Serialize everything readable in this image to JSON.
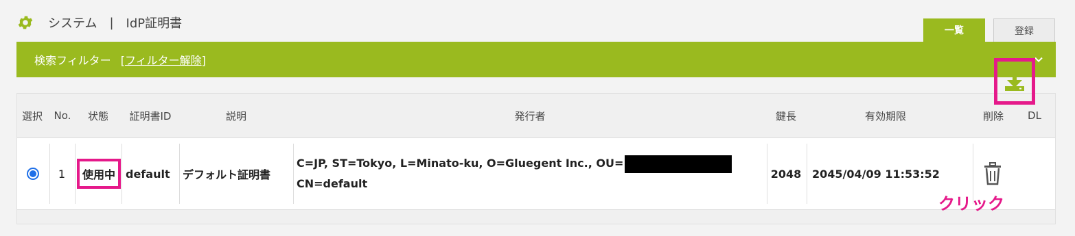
{
  "header": {
    "section": "システム",
    "separator": "|",
    "page": "IdP証明書"
  },
  "tabs": [
    {
      "label": "一覧",
      "active": true
    },
    {
      "label": "登録",
      "active": false
    }
  ],
  "filter": {
    "label": "検索フィルター",
    "clear_open": "[",
    "clear_label": "フィルター解除",
    "clear_close": "]"
  },
  "table": {
    "columns": [
      "選択",
      "No.",
      "状態",
      "証明書ID",
      "説明",
      "発行者",
      "鍵長",
      "有効期限",
      "削除",
      "DL"
    ],
    "rows": [
      {
        "selected": true,
        "no": "1",
        "status": "使用中",
        "cert_id": "default",
        "description": "デフォルト証明書",
        "issuer_line1": "C=JP, ST=Tokyo, L=Minato-ku, O=Gluegent Inc., OU=",
        "issuer_line2": "CN=default",
        "key_length": "2048",
        "expiry": "2045/04/09 11:53:52"
      }
    ]
  },
  "annotation": {
    "click_label": "クリック"
  },
  "colors": {
    "brand_green": "#9aba1f",
    "highlight_pink": "#e5198a",
    "radio_blue": "#1e6fe8"
  },
  "icons": {
    "settings": "gear-icon",
    "collapse": "chevron-down-icon",
    "delete": "trash-icon",
    "download": "download-icon"
  }
}
